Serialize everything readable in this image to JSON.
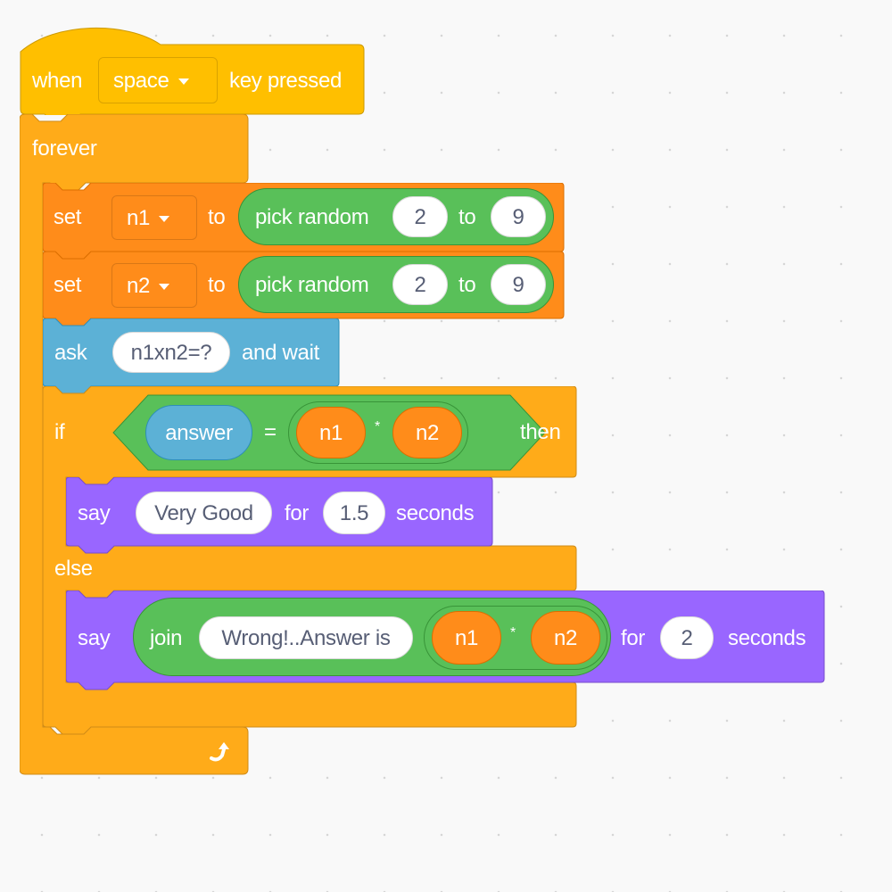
{
  "workspace": {
    "background": "#f9f9f9",
    "colors": {
      "events": "#ffbf00",
      "control": "#ffab19",
      "variables": "#ff8c1a",
      "sensing": "#5cb1d6",
      "looks": "#9966ff",
      "operators": "#59c059"
    }
  },
  "script": {
    "hat": {
      "when": "when",
      "key": "space",
      "key_pressed": "key pressed"
    },
    "forever": {
      "label": "forever",
      "loop_icon": "loop-arrow-icon"
    },
    "set1": {
      "set": "set",
      "variable": "n1",
      "to": "to",
      "pick_random": "pick random",
      "from": "2",
      "to2": "to",
      "max": "9"
    },
    "set2": {
      "set": "set",
      "variable": "n2",
      "to": "to",
      "pick_random": "pick random",
      "from": "2",
      "to2": "to",
      "max": "9"
    },
    "ask": {
      "ask": "ask",
      "question": "n1xn2=?",
      "and_wait": "and wait"
    },
    "if_else": {
      "if": "if",
      "answer": "answer",
      "equals": "=",
      "left_var": "n1",
      "times": "*",
      "right_var": "n2",
      "then": "then",
      "else": "else"
    },
    "say_good": {
      "say": "say",
      "message": "Very Good",
      "for": "for",
      "secs": "1.5",
      "seconds": "seconds"
    },
    "say_wrong": {
      "say": "say",
      "join": "join",
      "message": "Wrong!..Answer is",
      "left_var": "n1",
      "times": "*",
      "right_var": "n2",
      "for": "for",
      "secs": "2",
      "seconds": "seconds"
    }
  }
}
